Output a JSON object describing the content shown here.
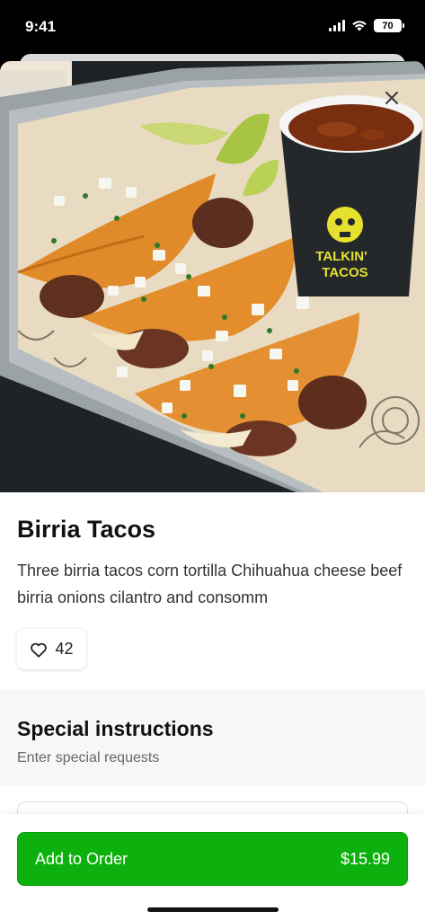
{
  "status_bar": {
    "time": "9:41",
    "battery": "70"
  },
  "item": {
    "name": "Birria Tacos",
    "description": "Three birria tacos corn tortilla Chihuahua cheese beef birria onions cilantro and consomm",
    "likes": "42",
    "cup_brand_line1": "TALKIN'",
    "cup_brand_line2": "TACOS"
  },
  "special_instructions": {
    "title": "Special instructions",
    "placeholder": "Enter special requests"
  },
  "order_button": {
    "label": "Add to Order",
    "price": "$15.99"
  },
  "colors": {
    "accent": "#0db10d",
    "tortilla": "#e08a2a",
    "consomme": "#7a2e10"
  }
}
